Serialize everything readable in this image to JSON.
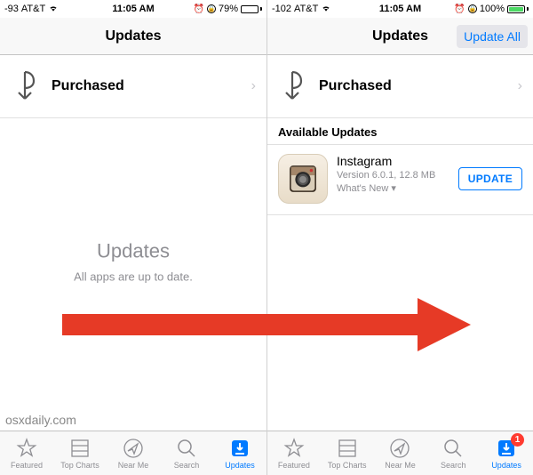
{
  "left": {
    "status": {
      "signal": "-93",
      "carrier": "AT&T",
      "time": "11:05 AM",
      "battery_pct": "79%",
      "battery_fill": "79%"
    },
    "header": {
      "title": "Updates"
    },
    "purchased": {
      "label": "Purchased"
    },
    "empty": {
      "title": "Updates",
      "subtitle": "All apps are up to date."
    },
    "tabs": {
      "featured": "Featured",
      "topcharts": "Top Charts",
      "nearme": "Near Me",
      "search": "Search",
      "updates": "Updates"
    }
  },
  "right": {
    "status": {
      "signal": "-102",
      "carrier": "AT&T",
      "time": "11:05 AM",
      "battery_pct": "100%",
      "battery_fill": "100%"
    },
    "header": {
      "title": "Updates",
      "update_all": "Update All"
    },
    "purchased": {
      "label": "Purchased"
    },
    "section": {
      "title": "Available Updates"
    },
    "app": {
      "name": "Instagram",
      "meta": "Version 6.0.1, 12.8 MB",
      "whats_new": "What's New ▾",
      "update_btn": "UPDATE"
    },
    "tabs": {
      "featured": "Featured",
      "topcharts": "Top Charts",
      "nearme": "Near Me",
      "search": "Search",
      "updates": "Updates",
      "badge": "1"
    }
  },
  "watermark": "osxdaily.com"
}
